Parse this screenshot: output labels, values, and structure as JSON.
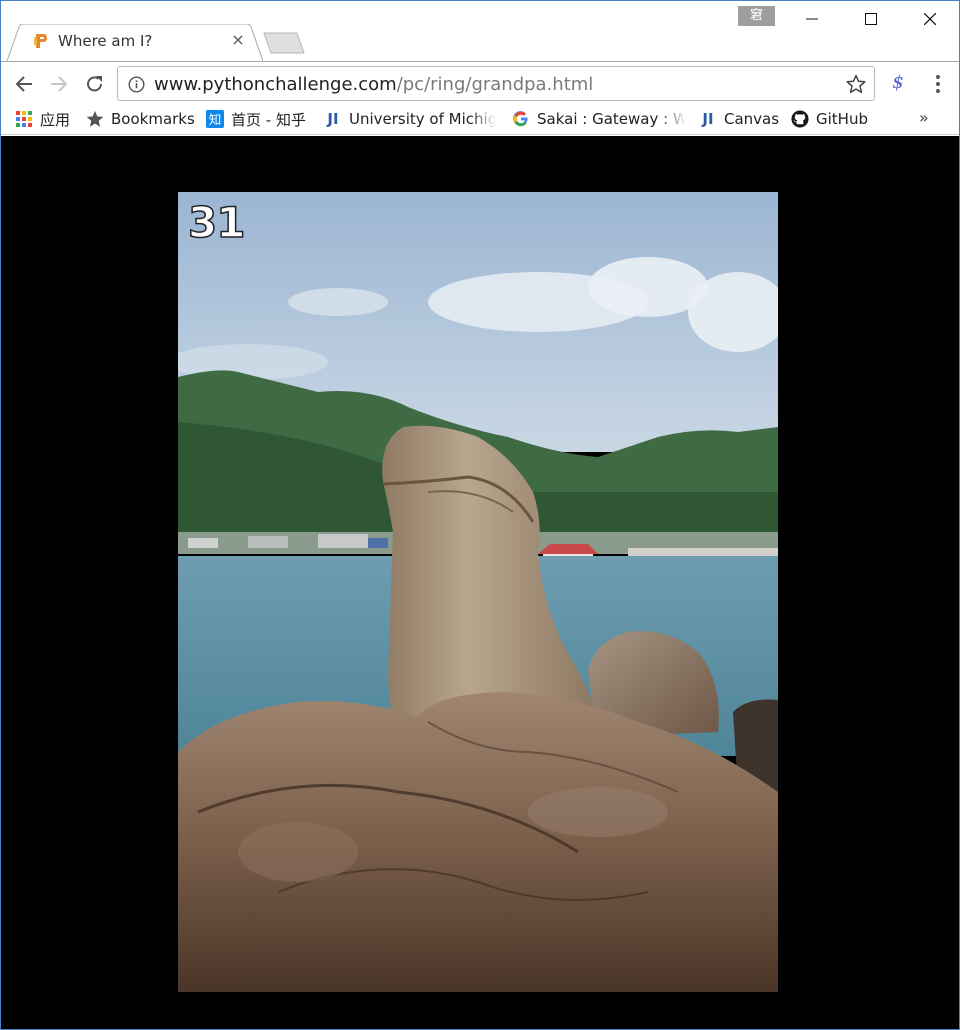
{
  "tab": {
    "title": "Where am I?",
    "close_symbol": "×"
  },
  "ime_indicator": "窘",
  "toolbar": {
    "url_domain": "www.pythonchallenge.com",
    "url_path": "/pc/ring/grandpa.html"
  },
  "bookmarks": [
    {
      "label": "应用",
      "icon": "apps-grid-icon"
    },
    {
      "label": "Bookmarks",
      "icon": "star-icon"
    },
    {
      "label": "首页 - 知乎",
      "icon": "zhihu-icon"
    },
    {
      "label": "University of Michig",
      "icon": "ji-icon"
    },
    {
      "label": "Sakai : Gateway : We",
      "icon": "google-icon"
    },
    {
      "label": "Canvas",
      "icon": "ji-icon"
    },
    {
      "label": "GitHub",
      "icon": "github-icon"
    }
  ],
  "bookmarks_more": "»",
  "content": {
    "background": "#000000",
    "image_label": "31",
    "image_subject": "rock-formation-on-coast"
  }
}
